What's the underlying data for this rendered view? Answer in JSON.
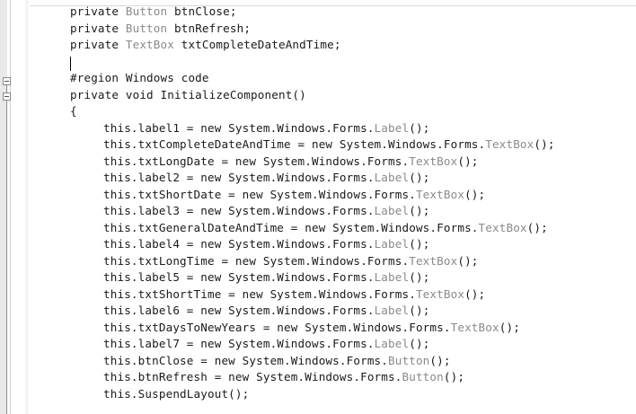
{
  "editor": {
    "lines": [
      {
        "indent": 1,
        "parts": [
          "private ",
          "Button",
          " btnClose;"
        ]
      },
      {
        "indent": 1,
        "parts": [
          "private ",
          "Button",
          " btnRefresh;"
        ]
      },
      {
        "indent": 1,
        "parts": [
          "private ",
          "TextBox",
          " txtCompleteDateAndTime;"
        ]
      },
      {
        "indent": 1,
        "parts": [
          "",
          "",
          ""
        ]
      },
      {
        "indent": 1,
        "parts": [
          "#region Windows code",
          "",
          ""
        ]
      },
      {
        "indent": 1,
        "parts": [
          "private void InitializeComponent()",
          "",
          ""
        ]
      },
      {
        "indent": 1,
        "parts": [
          "{",
          "",
          ""
        ]
      },
      {
        "indent": 2,
        "parts": [
          "this.label1 = new System.Windows.Forms.",
          "Label",
          "();"
        ]
      },
      {
        "indent": 2,
        "parts": [
          "this.txtCompleteDateAndTime = new System.Windows.Forms.",
          "TextBox",
          "();"
        ]
      },
      {
        "indent": 2,
        "parts": [
          "this.txtLongDate = new System.Windows.Forms.",
          "TextBox",
          "();"
        ]
      },
      {
        "indent": 2,
        "parts": [
          "this.label2 = new System.Windows.Forms.",
          "Label",
          "();"
        ]
      },
      {
        "indent": 2,
        "parts": [
          "this.txtShortDate = new System.Windows.Forms.",
          "TextBox",
          "();"
        ]
      },
      {
        "indent": 2,
        "parts": [
          "this.label3 = new System.Windows.Forms.",
          "Label",
          "();"
        ]
      },
      {
        "indent": 2,
        "parts": [
          "this.txtGeneralDateAndTime = new System.Windows.Forms.",
          "TextBox",
          "();"
        ]
      },
      {
        "indent": 2,
        "parts": [
          "this.label4 = new System.Windows.Forms.",
          "Label",
          "();"
        ]
      },
      {
        "indent": 2,
        "parts": [
          "this.txtLongTime = new System.Windows.Forms.",
          "TextBox",
          "();"
        ]
      },
      {
        "indent": 2,
        "parts": [
          "this.label5 = new System.Windows.Forms.",
          "Label",
          "();"
        ]
      },
      {
        "indent": 2,
        "parts": [
          "this.txtShortTime = new System.Windows.Forms.",
          "TextBox",
          "();"
        ]
      },
      {
        "indent": 2,
        "parts": [
          "this.label6 = new System.Windows.Forms.",
          "Label",
          "();"
        ]
      },
      {
        "indent": 2,
        "parts": [
          "this.txtDaysToNewYears = new System.Windows.Forms.",
          "TextBox",
          "();"
        ]
      },
      {
        "indent": 2,
        "parts": [
          "this.label7 = new System.Windows.Forms.",
          "Label",
          "();"
        ]
      },
      {
        "indent": 2,
        "parts": [
          "this.btnClose = new System.Windows.Forms.",
          "Button",
          "();"
        ]
      },
      {
        "indent": 2,
        "parts": [
          "this.btnRefresh = new System.Windows.Forms.",
          "Button",
          "();"
        ]
      },
      {
        "indent": 2,
        "parts": [
          "this.SuspendLayout();",
          "",
          ""
        ]
      }
    ]
  },
  "colors": {
    "type_highlight": "#8a8a8a",
    "text": "#1a1a1a",
    "background": "#ffffff"
  },
  "icons": {
    "fold_region": "collapse-region-icon",
    "fold_method": "collapse-method-icon"
  }
}
